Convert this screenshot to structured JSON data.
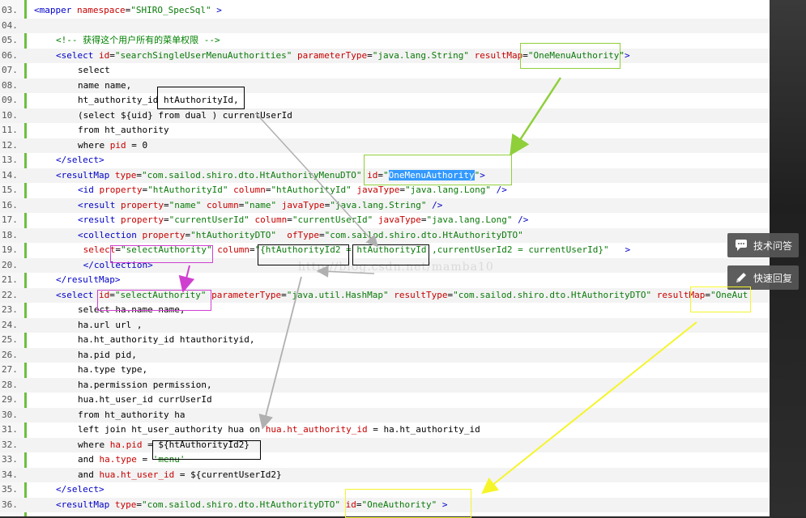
{
  "lines": [
    {
      "num": "03.",
      "segs": [
        {
          "t": "<",
          "c": "kw"
        },
        {
          "t": "mapper",
          "c": "kw"
        },
        {
          "t": " namespace",
          "c": "at"
        },
        {
          "t": "=",
          "c": ""
        },
        {
          "t": "\"SHIRO_SpecSql\"",
          "c": "va"
        },
        {
          "t": " >",
          "c": "kw"
        }
      ],
      "indent": 0
    },
    {
      "num": "04.",
      "segs": [],
      "indent": 0
    },
    {
      "num": "05.",
      "segs": [
        {
          "t": "<!-- 获得这个用户所有的菜单权限 -->",
          "c": "cm"
        }
      ],
      "indent": 1
    },
    {
      "num": "06.",
      "segs": [
        {
          "t": "<select",
          "c": "kw"
        },
        {
          "t": " id",
          "c": "at"
        },
        {
          "t": "=",
          "c": ""
        },
        {
          "t": "\"searchSingleUserMenuAuthorities\"",
          "c": "va"
        },
        {
          "t": " parameterType",
          "c": "at"
        },
        {
          "t": "=",
          "c": ""
        },
        {
          "t": "\"java.lang.String\"",
          "c": "va"
        },
        {
          "t": " resultMap",
          "c": "at"
        },
        {
          "t": "=",
          "c": ""
        },
        {
          "t": "\"OneMenuAuthority\"",
          "c": "va"
        },
        {
          "t": ">",
          "c": "kw"
        }
      ],
      "indent": 1
    },
    {
      "num": "07.",
      "segs": [
        {
          "t": "select",
          "c": ""
        }
      ],
      "indent": 2
    },
    {
      "num": "08.",
      "segs": [
        {
          "t": "name name,",
          "c": ""
        }
      ],
      "indent": 2
    },
    {
      "num": "09.",
      "segs": [
        {
          "t": "ht_authority_id htAuthorityId,",
          "c": ""
        }
      ],
      "indent": 2
    },
    {
      "num": "10.",
      "segs": [
        {
          "t": "(select ${uid} from dual ) currentUserId",
          "c": ""
        }
      ],
      "indent": 2
    },
    {
      "num": "11.",
      "segs": [
        {
          "t": "from ht_authority",
          "c": ""
        }
      ],
      "indent": 2
    },
    {
      "num": "12.",
      "segs": [
        {
          "t": "where ",
          "c": ""
        },
        {
          "t": "pid",
          "c": "at"
        },
        {
          "t": " = 0",
          "c": ""
        }
      ],
      "indent": 2
    },
    {
      "num": "13.",
      "segs": [
        {
          "t": "</select>",
          "c": "kw"
        }
      ],
      "indent": 1
    },
    {
      "num": "14.",
      "segs": [
        {
          "t": "<resultMap",
          "c": "kw"
        },
        {
          "t": " type",
          "c": "at"
        },
        {
          "t": "=",
          "c": ""
        },
        {
          "t": "\"com.sailod.shiro.dto.HtAuthorityMenuDTO\"",
          "c": "va"
        },
        {
          "t": " id",
          "c": "at"
        },
        {
          "t": "=",
          "c": ""
        },
        {
          "t": "\"",
          "c": "va"
        },
        {
          "t": "OneMenuAuthority",
          "c": "hl"
        },
        {
          "t": "\"",
          "c": "va"
        },
        {
          "t": ">",
          "c": "kw"
        }
      ],
      "indent": 1
    },
    {
      "num": "15.",
      "segs": [
        {
          "t": "<id",
          "c": "kw"
        },
        {
          "t": " property",
          "c": "at"
        },
        {
          "t": "=",
          "c": ""
        },
        {
          "t": "\"htAuthorityId\"",
          "c": "va"
        },
        {
          "t": " column",
          "c": "at"
        },
        {
          "t": "=",
          "c": ""
        },
        {
          "t": "\"htAuthorityId\"",
          "c": "va"
        },
        {
          "t": " javaType",
          "c": "at"
        },
        {
          "t": "=",
          "c": ""
        },
        {
          "t": "\"java.lang.Long\"",
          "c": "va"
        },
        {
          "t": " />",
          "c": "kw"
        }
      ],
      "indent": 2
    },
    {
      "num": "16.",
      "segs": [
        {
          "t": "<result",
          "c": "kw"
        },
        {
          "t": " property",
          "c": "at"
        },
        {
          "t": "=",
          "c": ""
        },
        {
          "t": "\"name\"",
          "c": "va"
        },
        {
          "t": " column",
          "c": "at"
        },
        {
          "t": "=",
          "c": ""
        },
        {
          "t": "\"name\"",
          "c": "va"
        },
        {
          "t": " javaType",
          "c": "at"
        },
        {
          "t": "=",
          "c": ""
        },
        {
          "t": "\"java.lang.String\"",
          "c": "va"
        },
        {
          "t": " />",
          "c": "kw"
        }
      ],
      "indent": 2
    },
    {
      "num": "17.",
      "segs": [
        {
          "t": "<result",
          "c": "kw"
        },
        {
          "t": " property",
          "c": "at"
        },
        {
          "t": "=",
          "c": ""
        },
        {
          "t": "\"currentUserId\"",
          "c": "va"
        },
        {
          "t": " column",
          "c": "at"
        },
        {
          "t": "=",
          "c": ""
        },
        {
          "t": "\"currentUserId\"",
          "c": "va"
        },
        {
          "t": " javaType",
          "c": "at"
        },
        {
          "t": "=",
          "c": ""
        },
        {
          "t": "\"java.lang.Long\"",
          "c": "va"
        },
        {
          "t": " />",
          "c": "kw"
        }
      ],
      "indent": 2
    },
    {
      "num": "18.",
      "segs": [
        {
          "t": "<collection",
          "c": "kw"
        },
        {
          "t": " property",
          "c": "at"
        },
        {
          "t": "=",
          "c": ""
        },
        {
          "t": "\"htAuthorityDTO\"",
          "c": "va"
        },
        {
          "t": "  ofType",
          "c": "at"
        },
        {
          "t": "=",
          "c": ""
        },
        {
          "t": "\"com.sailod.shiro.dto.HtAuthorityDTO\"",
          "c": "va"
        }
      ],
      "indent": 2
    },
    {
      "num": "19.",
      "segs": [
        {
          "t": " select",
          "c": "at"
        },
        {
          "t": "=",
          "c": ""
        },
        {
          "t": "\"selectAuthority\"",
          "c": "va"
        },
        {
          "t": " column",
          "c": "at"
        },
        {
          "t": "=",
          "c": ""
        },
        {
          "t": "\"{htAuthorityId2 = htAuthorityId ,currentUserId2 = currentUserId}\"",
          "c": "va"
        },
        {
          "t": "   >",
          "c": "kw"
        }
      ],
      "indent": 2
    },
    {
      "num": "20.",
      "segs": [
        {
          "t": " </collection>",
          "c": "kw"
        }
      ],
      "indent": 2
    },
    {
      "num": "21.",
      "segs": [
        {
          "t": "</resultMap>",
          "c": "kw"
        }
      ],
      "indent": 1
    },
    {
      "num": "22.",
      "segs": [
        {
          "t": "<select",
          "c": "kw"
        },
        {
          "t": " id",
          "c": "at"
        },
        {
          "t": "=",
          "c": ""
        },
        {
          "t": "\"selectAuthority\"",
          "c": "va"
        },
        {
          "t": " parameterType",
          "c": "at"
        },
        {
          "t": "=",
          "c": ""
        },
        {
          "t": "\"java.util.HashMap\"",
          "c": "va"
        },
        {
          "t": " resultType",
          "c": "at"
        },
        {
          "t": "=",
          "c": ""
        },
        {
          "t": "\"com.sailod.shiro.dto.HtAuthorityDTO\"",
          "c": "va"
        },
        {
          "t": " resultMap",
          "c": "at"
        },
        {
          "t": "=",
          "c": ""
        },
        {
          "t": "\"OneAut",
          "c": "va"
        }
      ],
      "indent": 1
    },
    {
      "num": "23.",
      "segs": [
        {
          "t": "select ha.name name,",
          "c": ""
        }
      ],
      "indent": 2
    },
    {
      "num": "24.",
      "segs": [
        {
          "t": "ha.url url ,",
          "c": ""
        }
      ],
      "indent": 2
    },
    {
      "num": "25.",
      "segs": [
        {
          "t": "ha.ht_authority_id htauthorityid,",
          "c": ""
        }
      ],
      "indent": 2
    },
    {
      "num": "26.",
      "segs": [
        {
          "t": "ha.pid pid,",
          "c": ""
        }
      ],
      "indent": 2
    },
    {
      "num": "27.",
      "segs": [
        {
          "t": "ha.type type,",
          "c": ""
        }
      ],
      "indent": 2
    },
    {
      "num": "28.",
      "segs": [
        {
          "t": "ha.permission permission,",
          "c": ""
        }
      ],
      "indent": 2
    },
    {
      "num": "29.",
      "segs": [
        {
          "t": "hua.ht_user_id currUserId",
          "c": ""
        }
      ],
      "indent": 2
    },
    {
      "num": "30.",
      "segs": [
        {
          "t": "from ht_authority ha",
          "c": ""
        }
      ],
      "indent": 2
    },
    {
      "num": "31.",
      "segs": [
        {
          "t": "left join ht_user_authority hua on ",
          "c": ""
        },
        {
          "t": "hua.ht_authority_id",
          "c": "at"
        },
        {
          "t": " = ha.ht_authority_id",
          "c": ""
        }
      ],
      "indent": 2
    },
    {
      "num": "32.",
      "segs": [
        {
          "t": "where ",
          "c": ""
        },
        {
          "t": "ha.pid",
          "c": "at"
        },
        {
          "t": " = ${htAuthorityId2}",
          "c": ""
        }
      ],
      "indent": 2
    },
    {
      "num": "33.",
      "segs": [
        {
          "t": "and ",
          "c": ""
        },
        {
          "t": "ha.type",
          "c": "at"
        },
        {
          "t": " = ",
          "c": ""
        },
        {
          "t": "'menu'",
          "c": "va"
        }
      ],
      "indent": 2
    },
    {
      "num": "34.",
      "segs": [
        {
          "t": "and ",
          "c": ""
        },
        {
          "t": "hua.ht_user_id",
          "c": "at"
        },
        {
          "t": " = ${currentUserId2}",
          "c": ""
        }
      ],
      "indent": 2
    },
    {
      "num": "35.",
      "segs": [
        {
          "t": "</select>",
          "c": "kw"
        }
      ],
      "indent": 1
    },
    {
      "num": "36.",
      "segs": [
        {
          "t": "<resultMap",
          "c": "kw"
        },
        {
          "t": " type",
          "c": "at"
        },
        {
          "t": "=",
          "c": ""
        },
        {
          "t": "\"com.sailod.shiro.dto.HtAuthorityDTO\"",
          "c": "va"
        },
        {
          "t": " id",
          "c": "at"
        },
        {
          "t": "=",
          "c": ""
        },
        {
          "t": "\"OneAuthority\"",
          "c": "va"
        },
        {
          "t": " >",
          "c": "kw"
        }
      ],
      "indent": 1
    }
  ],
  "watermark": "http://blog.csdn.net/mamba10",
  "side_buttons": {
    "tech_qa": "技术问答",
    "quick_reply": "快速回复"
  },
  "icons": {
    "tech_qa": "chat-bubble-icon",
    "quick_reply": "pencil-icon"
  },
  "colors": {
    "green_box": "#8fcf3a",
    "yellow_box": "#f5f52a",
    "magenta_box": "#d040d0",
    "black_box": "#000000",
    "gutter_border": "#6cbf3f"
  }
}
